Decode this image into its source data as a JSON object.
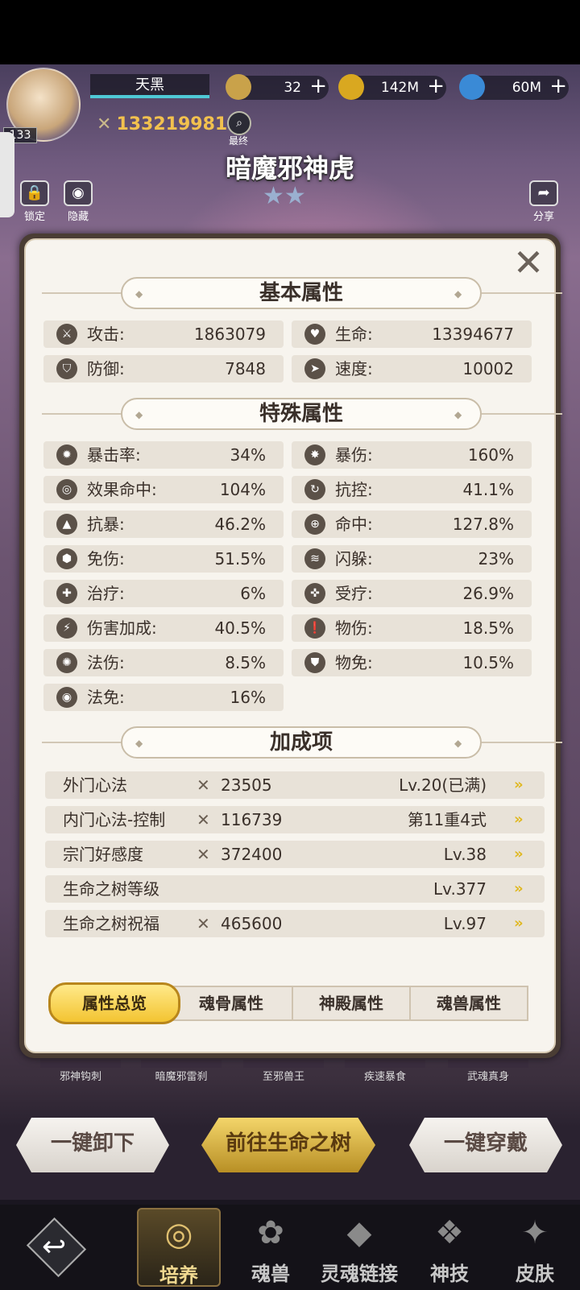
{
  "header": {
    "player_name": "天黑",
    "level": "133",
    "power": "133219981",
    "search_label": "最终",
    "hero_name": "暗魔邪神虎",
    "stars": "★★",
    "lock_label": "锁定",
    "hide_label": "隐藏",
    "share_label": "分享",
    "resources": [
      {
        "icon": "coin-icon",
        "value": "32",
        "color": "#c9a24a"
      },
      {
        "icon": "gold-icon",
        "value": "142M",
        "color": "#d9a820"
      },
      {
        "icon": "potion-icon",
        "value": "60M",
        "color": "#3a8ad6"
      }
    ]
  },
  "modal": {
    "basic_title": "基本属性",
    "special_title": "特殊属性",
    "bonus_title": "加成项",
    "basic": [
      {
        "label": "攻击:",
        "value": "1863079",
        "icon": "attack-icon"
      },
      {
        "label": "生命:",
        "value": "13394677",
        "icon": "hp-icon"
      },
      {
        "label": "防御:",
        "value": "7848",
        "icon": "defense-icon"
      },
      {
        "label": "速度:",
        "value": "10002",
        "icon": "speed-icon"
      }
    ],
    "special": [
      {
        "label": "暴击率:",
        "value": "34%",
        "icon": "crit-rate-icon"
      },
      {
        "label": "暴伤:",
        "value": "160%",
        "icon": "crit-damage-icon"
      },
      {
        "label": "效果命中:",
        "value": "104%",
        "icon": "effect-hit-icon"
      },
      {
        "label": "抗控:",
        "value": "41.1%",
        "icon": "control-resist-icon"
      },
      {
        "label": "抗暴:",
        "value": "46.2%",
        "icon": "crit-resist-icon"
      },
      {
        "label": "命中:",
        "value": "127.8%",
        "icon": "hit-icon"
      },
      {
        "label": "免伤:",
        "value": "51.5%",
        "icon": "damage-reduction-icon"
      },
      {
        "label": "闪躲:",
        "value": "23%",
        "icon": "dodge-icon"
      },
      {
        "label": "治疗:",
        "value": "6%",
        "icon": "heal-icon"
      },
      {
        "label": "受疗:",
        "value": "26.9%",
        "icon": "heal-received-icon"
      },
      {
        "label": "伤害加成:",
        "value": "40.5%",
        "icon": "damage-bonus-icon"
      },
      {
        "label": "物伤:",
        "value": "18.5%",
        "icon": "physical-damage-icon"
      },
      {
        "label": "法伤:",
        "value": "8.5%",
        "icon": "magic-damage-icon"
      },
      {
        "label": "物免:",
        "value": "10.5%",
        "icon": "physical-immunity-icon"
      },
      {
        "label": "法免:",
        "value": "16%",
        "icon": "magic-immunity-icon"
      }
    ],
    "bonus": [
      {
        "label": "外门心法",
        "power": "23505",
        "level": "Lv.20(已满)"
      },
      {
        "label": "内门心法-控制",
        "power": "116739",
        "level": "第11重4式"
      },
      {
        "label": "宗门好感度",
        "power": "372400",
        "level": "Lv.38"
      },
      {
        "label": "生命之树等级",
        "power": "",
        "level": "Lv.377"
      },
      {
        "label": "生命之树祝福",
        "power": "465600",
        "level": "Lv.97"
      }
    ],
    "tabs": [
      "属性总览",
      "魂骨属性",
      "神殿属性",
      "魂兽属性"
    ]
  },
  "skills": [
    "邪神钩刺",
    "暗魔邪雷刹",
    "至邪兽王",
    "疾速暴食",
    "武魂真身"
  ],
  "bottom_buttons": {
    "unequip": "一键卸下",
    "tree": "前往生命之树",
    "equip": "一键穿戴"
  },
  "nav": [
    {
      "label": "培养",
      "icon": "cultivate-icon"
    },
    {
      "label": "魂兽",
      "icon": "paw-icon"
    },
    {
      "label": "灵魂链接",
      "icon": "soul-link-icon"
    },
    {
      "label": "神技",
      "icon": "divine-skill-icon"
    },
    {
      "label": "皮肤",
      "icon": "skin-icon"
    }
  ]
}
